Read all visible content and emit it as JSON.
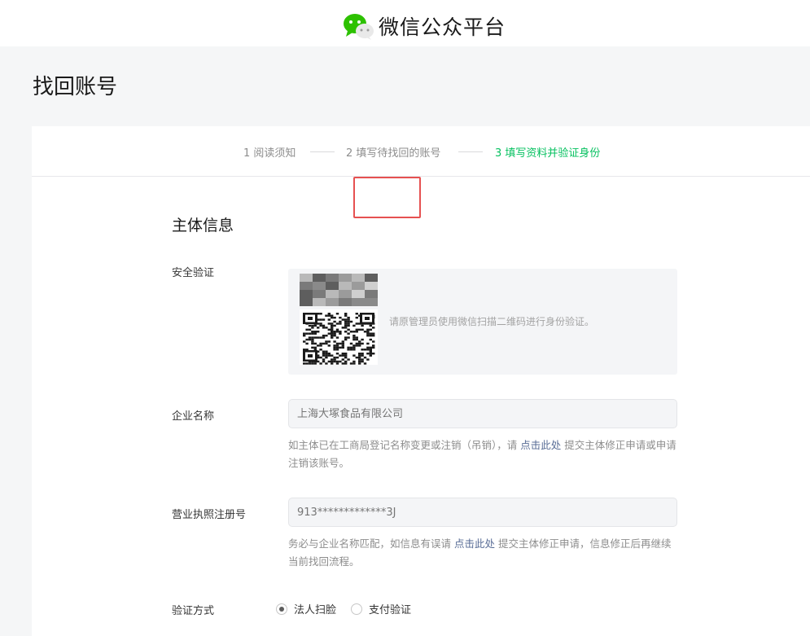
{
  "header": {
    "brand_name": "微信公众平台",
    "logo_icon": "wechat-logo-icon",
    "accent_color": "#07c160"
  },
  "page": {
    "title": "找回账号"
  },
  "steps": [
    {
      "label": "1 阅读须知",
      "active": false
    },
    {
      "label": "2 填写待找回的账号",
      "active": false
    },
    {
      "label": "3 填写资料并验证身份",
      "active": true
    }
  ],
  "form": {
    "section_title": "主体信息",
    "security": {
      "label": "安全验证",
      "qr_tip": "请原管理员使用微信扫描二维码进行身份验证。"
    },
    "company": {
      "label": "企业名称",
      "placeholder": "上海大塚食品有限公司",
      "help_before": "如主体已在工商局登记名称变更或注销（吊销），请 ",
      "help_link": "点击此处",
      "help_after": " 提交主体修正申请或申请注销该账号。"
    },
    "license": {
      "label": "营业执照注册号",
      "placeholder": "913*************3J",
      "help_before": "务必与企业名称匹配，如信息有误请 ",
      "help_link": "点击此处",
      "help_after": " 提交主体修正申请，信息修正后再继续当前找回流程。"
    },
    "verify_method": {
      "label": "验证方式",
      "options": [
        {
          "label": "法人扫脸",
          "checked": true
        },
        {
          "label": "支付验证",
          "checked": false
        }
      ]
    }
  },
  "highlight_color": "#e65151"
}
